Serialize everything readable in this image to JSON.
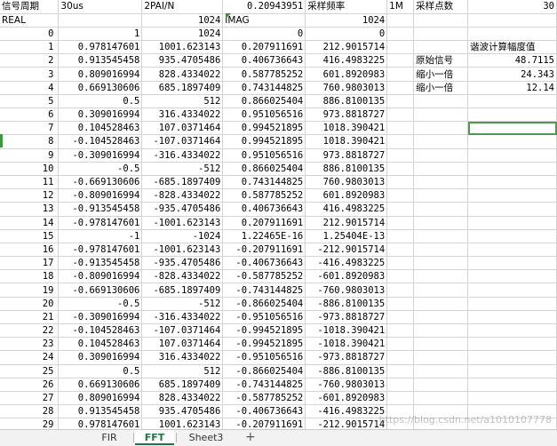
{
  "headers": [
    [
      "信号周期",
      "30us",
      "2PAI/N",
      "0.20943951",
      "采样频率",
      "1M",
      "采样点数",
      "30"
    ],
    [
      "REAL",
      "",
      "1024",
      "IMAG",
      "1024",
      "",
      "",
      ""
    ]
  ],
  "rows": [
    [
      "0",
      "1",
      "1024",
      "0",
      "0"
    ],
    [
      "1",
      "0.978147601",
      "1001.623143",
      "0.207911691",
      "212.9015714"
    ],
    [
      "2",
      "0.913545458",
      "935.4705486",
      "0.406736643",
      "416.4983225"
    ],
    [
      "3",
      "0.809016994",
      "828.4334022",
      "0.587785252",
      "601.8920983"
    ],
    [
      "4",
      "0.669130606",
      "685.1897409",
      "0.743144825",
      "760.9803013"
    ],
    [
      "5",
      "0.5",
      "512",
      "0.866025404",
      "886.8100135"
    ],
    [
      "6",
      "0.309016994",
      "316.4334022",
      "0.951056516",
      "973.8818727"
    ],
    [
      "7",
      "0.104528463",
      "107.0371464",
      "0.994521895",
      "1018.390421"
    ],
    [
      "8",
      "-0.104528463",
      "-107.0371464",
      "0.994521895",
      "1018.390421"
    ],
    [
      "9",
      "-0.309016994",
      "-316.4334022",
      "0.951056516",
      "973.8818727"
    ],
    [
      "10",
      "-0.5",
      "-512",
      "0.866025404",
      "886.8100135"
    ],
    [
      "11",
      "-0.669130606",
      "-685.1897409",
      "0.743144825",
      "760.9803013"
    ],
    [
      "12",
      "-0.809016994",
      "-828.4334022",
      "0.587785252",
      "601.8920983"
    ],
    [
      "13",
      "-0.913545458",
      "-935.4705486",
      "0.406736643",
      "416.4983225"
    ],
    [
      "14",
      "-0.978147601",
      "-1001.623143",
      "0.207911691",
      "212.9015714"
    ],
    [
      "15",
      "-1",
      "-1024",
      "1.22465E-16",
      "1.25404E-13"
    ],
    [
      "16",
      "-0.978147601",
      "-1001.623143",
      "-0.207911691",
      "-212.9015714"
    ],
    [
      "17",
      "-0.913545458",
      "-935.4705486",
      "-0.406736643",
      "-416.4983225"
    ],
    [
      "18",
      "-0.809016994",
      "-828.4334022",
      "-0.587785252",
      "-601.8920983"
    ],
    [
      "19",
      "-0.669130606",
      "-685.1897409",
      "-0.743144825",
      "-760.9803013"
    ],
    [
      "20",
      "-0.5",
      "-512",
      "-0.866025404",
      "-886.8100135"
    ],
    [
      "21",
      "-0.309016994",
      "-316.4334022",
      "-0.951056516",
      "-973.8818727"
    ],
    [
      "22",
      "-0.104528463",
      "-107.0371464",
      "-0.994521895",
      "-1018.390421"
    ],
    [
      "23",
      "0.104528463",
      "107.0371464",
      "-0.994521895",
      "-1018.390421"
    ],
    [
      "24",
      "0.309016994",
      "316.4334022",
      "-0.951056516",
      "-973.8818727"
    ],
    [
      "25",
      "0.5",
      "512",
      "-0.866025404",
      "-886.8100135"
    ],
    [
      "26",
      "0.669130606",
      "685.1897409",
      "-0.743144825",
      "-760.9803013"
    ],
    [
      "27",
      "0.809016994",
      "828.4334022",
      "-0.587785252",
      "-601.8920983"
    ],
    [
      "28",
      "0.913545458",
      "935.4705486",
      "-0.406736643",
      "-416.4983225"
    ],
    [
      "29",
      "0.978147601",
      "1001.623143",
      "-0.207911691",
      "-212.9015714"
    ]
  ],
  "side": {
    "title": "谐波计算幅度值",
    "items": [
      {
        "label": "原始信号",
        "value": "48.7115"
      },
      {
        "label": "缩小一倍",
        "value": "24.343"
      },
      {
        "label": "缩小一倍",
        "value": "12.14"
      }
    ]
  },
  "tabs": [
    "FIR",
    "FFT",
    "Sheet3"
  ],
  "active_tab": "FFT",
  "add_tab_glyph": "+",
  "watermark": "https://blog.csdn.net/a1010107778",
  "colors": {
    "active_tab": "#217346",
    "selection": "#4c9a4c",
    "grid": "#d4d4d4"
  }
}
